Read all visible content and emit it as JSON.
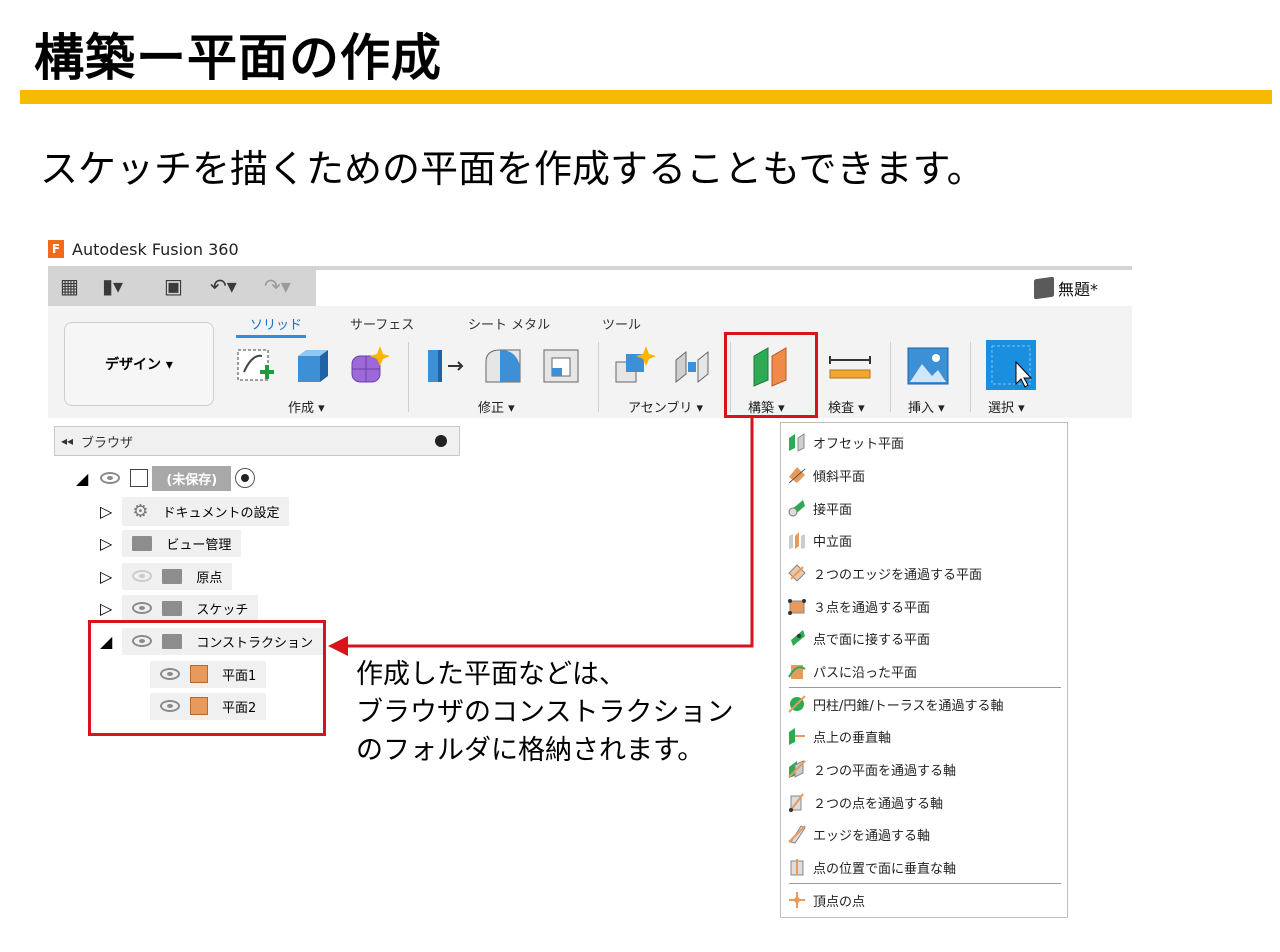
{
  "slide": {
    "title": "構築ー平面の作成",
    "subtitle": "スケッチを描くための平面を作成することもできます。",
    "accent_color": "#f5bb00",
    "highlight_color": "#d9121b",
    "annotation_lines": [
      "作成した平面などは、",
      "ブラウザのコンストラクション",
      "のフォルダに格納されます。"
    ]
  },
  "app": {
    "logo": "F",
    "name": "Autodesk Fusion 360",
    "document_title": "無題*"
  },
  "ribbon": {
    "workspace": "デザイン ▾",
    "tabs": [
      "ソリッド",
      "サーフェス",
      "シート メタル",
      "ツール"
    ],
    "groups": [
      "作成 ▾",
      "修正 ▾",
      "アセンブリ ▾",
      "構築 ▾",
      "検査 ▾",
      "挿入 ▾",
      "選択 ▾"
    ]
  },
  "browser": {
    "title": "ブラウザ",
    "root_label": "(未保存)",
    "items": [
      "ドキュメントの設定",
      "ビュー管理",
      "原点",
      "スケッチ",
      "コンストラクション"
    ],
    "planes": [
      "平面1",
      "平面2"
    ]
  },
  "construct_menu": {
    "planes": [
      "オフセット平面",
      "傾斜平面",
      "接平面",
      "中立面",
      "２つのエッジを通過する平面",
      "３点を通過する平面",
      "点で面に接する平面",
      "パスに沿った平面"
    ],
    "axes": [
      "円柱/円錐/トーラスを通過する軸",
      "点上の垂直軸",
      "２つの平面を通過する軸",
      "２つの点を通過する軸",
      "エッジを通過する軸",
      "点の位置で面に垂直な軸"
    ],
    "points": [
      "頂点の点"
    ]
  },
  "icons": [
    "grid-icon",
    "file-icon",
    "save-icon",
    "undo-icon",
    "redo-icon",
    "cube-icon",
    "eye-icon",
    "gear-icon",
    "folder-icon",
    "plane-icon"
  ]
}
